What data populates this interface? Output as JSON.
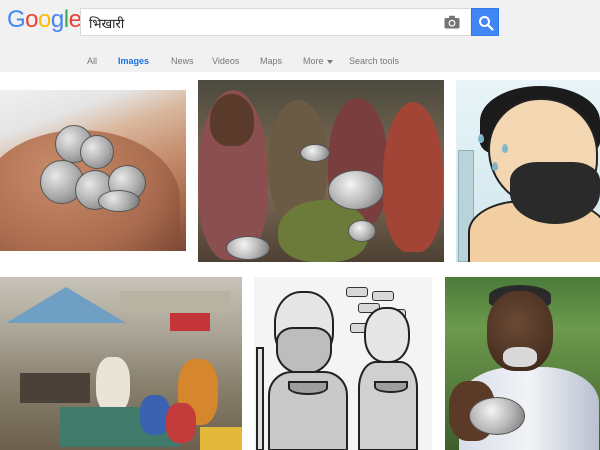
{
  "logo": {
    "letters": [
      "G",
      "o",
      "o",
      "g",
      "l",
      "e"
    ],
    "colors": [
      "#4285F4",
      "#EA4335",
      "#FBBC05",
      "#4285F4",
      "#34A853",
      "#EA4335"
    ]
  },
  "search": {
    "query": "भिखारी",
    "camera_icon": "camera-icon",
    "button_icon": "magnifier-icon",
    "button_color": "#4285f4"
  },
  "nav": {
    "items": [
      {
        "label": "All"
      },
      {
        "label": "Images",
        "active": true
      },
      {
        "label": "News"
      },
      {
        "label": "Videos"
      },
      {
        "label": "Maps"
      },
      {
        "label": "More"
      },
      {
        "label": "Search tools"
      }
    ],
    "active_color": "#1a73e8"
  },
  "results": {
    "tiles": [
      {
        "subject": "coins-in-hand"
      },
      {
        "subject": "children-with-bowls"
      },
      {
        "subject": "cartoon-man"
      },
      {
        "subject": "street-scene"
      },
      {
        "subject": "cartoon-two-beggars"
      },
      {
        "subject": "old-man-with-bowl"
      }
    ]
  }
}
